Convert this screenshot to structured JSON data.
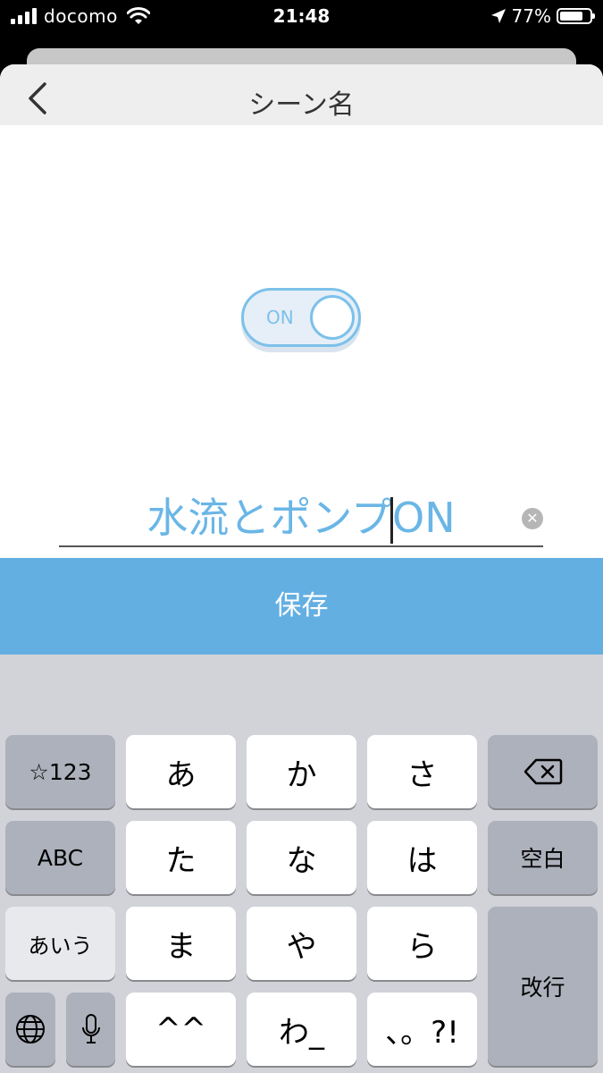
{
  "status_bar": {
    "carrier": "docomo",
    "time": "21:48",
    "battery": "77%",
    "battery_level": 0.77
  },
  "nav": {
    "title": "シーン名",
    "back_icon": "chevron-left-icon"
  },
  "toggle": {
    "label": "ON",
    "state": "on"
  },
  "name_input": {
    "value": "水流とポンプON",
    "clear_icon": "clear-icon"
  },
  "save_button": {
    "label": "保存"
  },
  "keyboard": {
    "keys": {
      "symbols": "☆123",
      "a": "あ",
      "ka": "か",
      "sa": "さ",
      "delete_icon": "backspace-icon",
      "abc": "ABC",
      "ta": "た",
      "na": "な",
      "ha": "は",
      "space": "空白",
      "aiu": "あいう",
      "ma": "ま",
      "ya": "や",
      "ra": "ら",
      "enter": "改行",
      "globe_icon": "globe-icon",
      "mic_icon": "microphone-icon",
      "dakuten": "^^",
      "wa": "わ_",
      "punct": "、。?!"
    }
  },
  "colors": {
    "accent": "#63afe2",
    "toggle_stroke": "#7cc1ea",
    "input_text": "#6ab6e6",
    "nav_background": "#eeeeee",
    "keyboard_background": "#d1d3d9"
  }
}
